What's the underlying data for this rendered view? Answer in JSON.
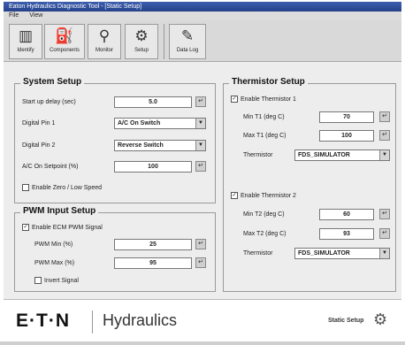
{
  "window": {
    "title": "Eaton Hydraulics Diagnostic Tool - [Static Setup]"
  },
  "menu": [
    "File",
    "View"
  ],
  "toolbar": [
    {
      "label": "Identify",
      "icon": "identify-icon",
      "glyph": "▥"
    },
    {
      "label": "Components",
      "icon": "components-icon",
      "glyph": "⛽"
    },
    {
      "label": "Monitor",
      "icon": "binoculars-icon",
      "glyph": "⚲"
    },
    {
      "label": "Setup",
      "icon": "setup-icon",
      "glyph": "⚙"
    },
    {
      "label": "Data Log",
      "icon": "datalog-icon",
      "glyph": "✎"
    }
  ],
  "system_setup": {
    "title": "System Setup",
    "startup_delay": {
      "label": "Start up delay (sec)",
      "value": "5.0"
    },
    "digital_pin1": {
      "label": "Digital Pin 1",
      "value": "A/C On Switch"
    },
    "digital_pin2": {
      "label": "Digital Pin 2",
      "value": "Reverse Switch"
    },
    "ac_setpoint": {
      "label": "A/C On Setpoint (%)",
      "value": "100"
    },
    "zero_low_speed": {
      "label": "Enable Zero / Low Speed",
      "checked": false
    }
  },
  "pwm_setup": {
    "title": "PWM Input Setup",
    "enable_ecm": {
      "label": "Enable ECM PWM Signal",
      "checked": true
    },
    "pwm_min": {
      "label": "PWM Min (%)",
      "value": "25"
    },
    "pwm_max": {
      "label": "PWM Max (%)",
      "value": "95"
    },
    "invert": {
      "label": "Invert Signal",
      "checked": false
    }
  },
  "thermistor_setup": {
    "title": "Thermistor Setup",
    "t1": {
      "enable": {
        "label": "Enable Thermistor 1",
        "checked": true
      },
      "min": {
        "label": "Min T1 (deg C)",
        "value": "70"
      },
      "max": {
        "label": "Max T1 (deg C)",
        "value": "100"
      },
      "thermistor": {
        "label": "Thermistor",
        "value": "FDS_SIMULATOR"
      }
    },
    "t2": {
      "enable": {
        "label": "Enable Thermistor 2",
        "checked": true
      },
      "min": {
        "label": "Min T2 (deg C)",
        "value": "60"
      },
      "max": {
        "label": "Max T2 (deg C)",
        "value": "93"
      },
      "thermistor": {
        "label": "Thermistor",
        "value": "FDS_SIMULATOR"
      }
    }
  },
  "footer": {
    "brand": "E·T·N",
    "division": "Hydraulics",
    "status": "Static Setup"
  },
  "colors": {
    "titlebar": "#26418a",
    "panel": "#ededed"
  }
}
